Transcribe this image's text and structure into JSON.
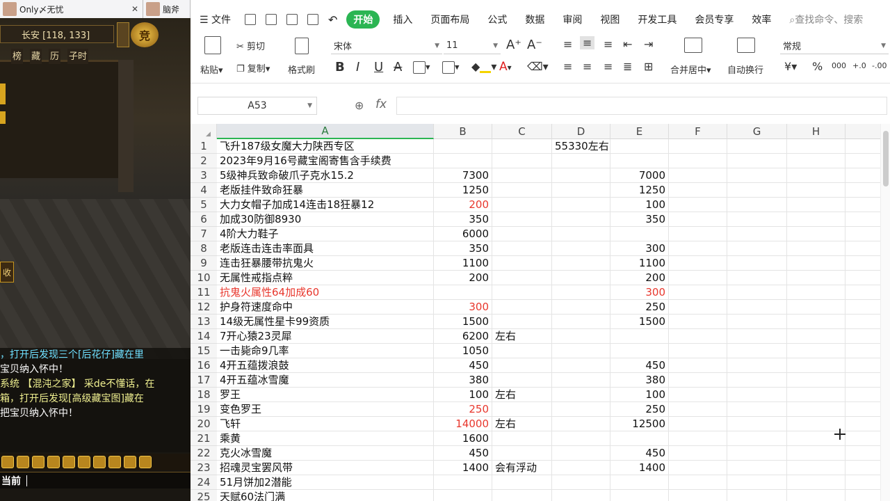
{
  "game": {
    "tabs": [
      {
        "label": "Only〆无忧"
      },
      {
        "label": "脑斧"
      }
    ],
    "location": "长安 [118, 133]",
    "badge": "竞",
    "menu": [
      "榜",
      "藏",
      "历",
      "子时"
    ],
    "shou_label": "收",
    "chat": [
      {
        "text": "，打开后发现三个[后花仔]藏在里",
        "color": "c-c"
      },
      {
        "text": "宝贝纳入怀中！",
        "color": "c-w"
      },
      {
        "text": "系统 【混沌之家】 采de不懂话，在",
        "color": "c-y"
      },
      {
        "text": "箱，打开后发现[高级藏宝图]藏在",
        "color": "c-y"
      },
      {
        "text": "把宝贝纳入怀中！",
        "color": "c-w"
      }
    ],
    "input_label": "当前"
  },
  "menu": {
    "file": "文件",
    "tabs": [
      "开始",
      "插入",
      "页面布局",
      "公式",
      "数据",
      "审阅",
      "视图",
      "开发工具",
      "会员专享",
      "效率"
    ],
    "search": "查找命令、搜索"
  },
  "ribbon": {
    "paste": "粘贴",
    "cut": "剪切",
    "copy": "复制",
    "format_painter": "格式刷",
    "font_name": "宋体",
    "font_size": "11",
    "merge": "合并居中",
    "wrap": "自动换行",
    "number_format": "常规",
    "currency": "¥",
    "percent": "%",
    "thousands": "000",
    "dec_inc": "+.0",
    "dec_dec": "-.00"
  },
  "formula_bar": {
    "name_box": "A53",
    "fx": "fx",
    "formula": ""
  },
  "columns": [
    "A",
    "B",
    "C",
    "D",
    "E",
    "F",
    "G",
    "H"
  ],
  "selected_column": "A",
  "rows": [
    {
      "n": "1",
      "A": "飞升187级女魔大力陕西专区",
      "B": "",
      "C": "",
      "D": "55330左右",
      "E": ""
    },
    {
      "n": "2",
      "A": "2023年9月16号藏宝阁寄售含手续费",
      "B": "",
      "C": "",
      "D": "",
      "E": ""
    },
    {
      "n": "3",
      "A": "5级神兵致命破爪子克水15.2",
      "B": "7300",
      "C": "",
      "D": "",
      "E": "7000"
    },
    {
      "n": "4",
      "A": "老版挂件致命狂暴",
      "B": "1250",
      "C": "",
      "D": "",
      "E": "1250"
    },
    {
      "n": "5",
      "A": "大力女帽子加成14连击18狂暴12",
      "B": "200",
      "B_red": true,
      "C": "",
      "D": "",
      "E": "100"
    },
    {
      "n": "6",
      "A": "加成30防御8930",
      "B": "350",
      "C": "",
      "D": "",
      "E": "350"
    },
    {
      "n": "7",
      "A": "4阶大力鞋子",
      "B": "6000",
      "C": "",
      "D": "",
      "E": ""
    },
    {
      "n": "8",
      "A": "老版连击连击率面具",
      "B": "350",
      "C": "",
      "D": "",
      "E": "300"
    },
    {
      "n": "9",
      "A": "连击狂暴腰带抗鬼火",
      "B": "1100",
      "C": "",
      "D": "",
      "E": "1100"
    },
    {
      "n": "10",
      "A": "无属性戒指点粹",
      "B": "200",
      "C": "",
      "D": "",
      "E": "200"
    },
    {
      "n": "11",
      "A": "抗鬼火属性64加成60",
      "A_red": true,
      "B": "",
      "C": "",
      "D": "",
      "E": "300",
      "E_red": true
    },
    {
      "n": "12",
      "A": "护身符速度命中",
      "B": "300",
      "B_red": true,
      "C": "",
      "D": "",
      "E": "250"
    },
    {
      "n": "13",
      "A": "14级无属性星卡99资质",
      "B": "1500",
      "C": "",
      "D": "",
      "E": "1500"
    },
    {
      "n": "14",
      "A": "7开心猿23灵犀",
      "B": "6200",
      "C": "左右",
      "D": "",
      "E": ""
    },
    {
      "n": "15",
      "A": "一击毙命9几率",
      "B": "1050",
      "C": "",
      "D": "",
      "E": ""
    },
    {
      "n": "16",
      "A": "4开五蕴拨浪鼓",
      "B": "450",
      "C": "",
      "D": "",
      "E": "450"
    },
    {
      "n": "17",
      "A": "4开五蕴冰雪魔",
      "B": "380",
      "C": "",
      "D": "",
      "E": "380"
    },
    {
      "n": "18",
      "A": "罗王",
      "B": "100",
      "C": "左右",
      "D": "",
      "E": "100"
    },
    {
      "n": "19",
      "A": "变色罗王",
      "B": "250",
      "B_red": true,
      "C": "",
      "D": "",
      "E": "250"
    },
    {
      "n": "20",
      "A": "飞轩",
      "B": "14000",
      "B_red": true,
      "C": "左右",
      "D": "",
      "E": "12500"
    },
    {
      "n": "21",
      "A": "乘黄",
      "B": "1600",
      "C": "",
      "D": "",
      "E": ""
    },
    {
      "n": "22",
      "A": "克火冰雪魔",
      "B": "450",
      "C": "",
      "D": "",
      "E": "450"
    },
    {
      "n": "23",
      "A": "招魂灵宝罢风带",
      "B": "1400",
      "C": "会有浮动",
      "D": "",
      "E": "1400"
    },
    {
      "n": "24",
      "A": "51月饼加2潜能",
      "B": "",
      "C": "",
      "D": "",
      "E": ""
    },
    {
      "n": "25",
      "A": "天赋60法门满",
      "B": "",
      "C": "",
      "D": "",
      "E": ""
    }
  ]
}
